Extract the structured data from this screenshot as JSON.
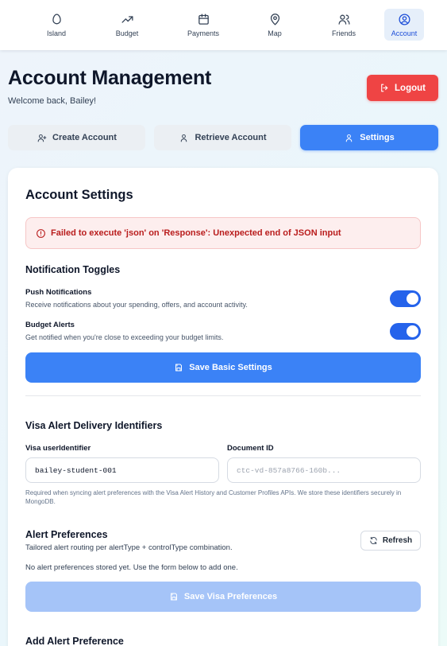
{
  "nav": {
    "items": [
      {
        "label": "Island",
        "icon": "egg-icon",
        "active": false
      },
      {
        "label": "Budget",
        "icon": "trending-up-icon",
        "active": false
      },
      {
        "label": "Payments",
        "icon": "calendar-icon",
        "active": false
      },
      {
        "label": "Map",
        "icon": "map-pin-icon",
        "active": false
      },
      {
        "label": "Friends",
        "icon": "users-icon",
        "active": false
      },
      {
        "label": "Account",
        "icon": "user-circle-icon",
        "active": true
      }
    ]
  },
  "header": {
    "title": "Account Management",
    "welcome": "Welcome back, Bailey!",
    "logout_label": "Logout"
  },
  "tabs": [
    {
      "label": "Create Account",
      "icon": "user-plus-icon",
      "active": false
    },
    {
      "label": "Retrieve Account",
      "icon": "user-icon",
      "active": false
    },
    {
      "label": "Settings",
      "icon": "user-icon",
      "active": true
    }
  ],
  "settings": {
    "title": "Account Settings",
    "error_message": "Failed to execute 'json' on 'Response': Unexpected end of JSON input",
    "notifications": {
      "heading": "Notification Toggles",
      "push": {
        "title": "Push Notifications",
        "description": "Receive notifications about your spending, offers, and account activity.",
        "enabled": true
      },
      "budget": {
        "title": "Budget Alerts",
        "description": "Get notified when you're close to exceeding your budget limits.",
        "enabled": true
      },
      "save_label": "Save Basic Settings"
    },
    "visa": {
      "heading": "Visa Alert Delivery Identifiers",
      "user_id_label": "Visa userIdentifier",
      "user_id_value": "bailey-student-001",
      "doc_id_label": "Document ID",
      "doc_id_placeholder": "ctc-vd-857a8766-160b...",
      "helper": "Required when syncing alert preferences with the Visa Alert History and Customer Profiles APIs. We store these identifiers securely in MongoDB."
    },
    "alerts": {
      "heading": "Alert Preferences",
      "subheading": "Tailored alert routing per alertType + controlType combination.",
      "refresh_label": "Refresh",
      "empty_message": "No alert preferences stored yet. Use the form below to add one.",
      "save_label": "Save Visa Preferences",
      "add_heading": "Add Alert Preference"
    }
  },
  "colors": {
    "primary": "#3b82f6",
    "danger": "#ef4444",
    "toggle_on": "#2563eb"
  }
}
